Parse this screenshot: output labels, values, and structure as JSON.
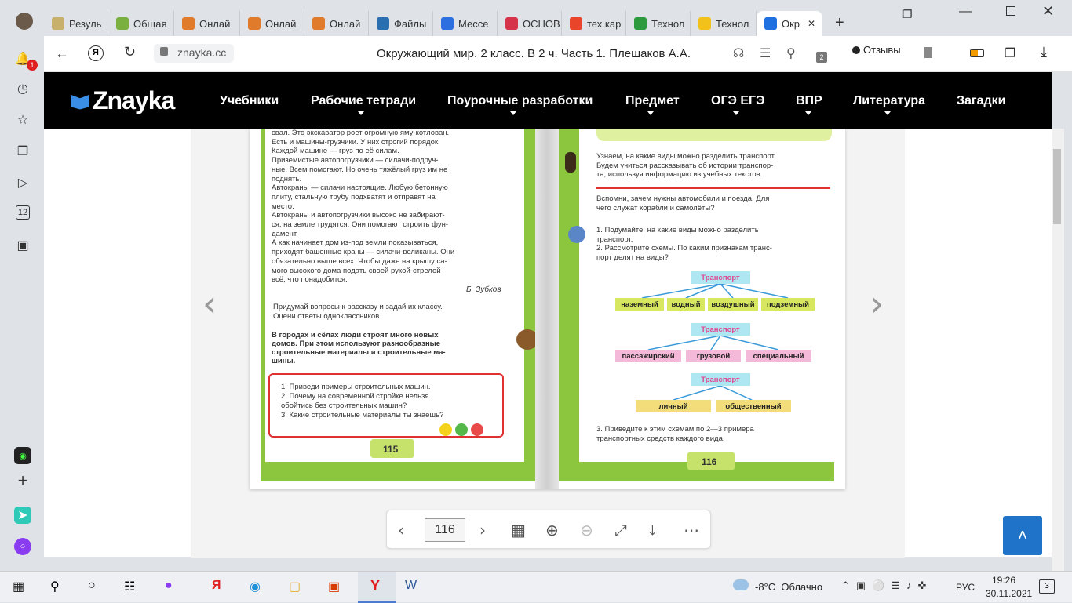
{
  "tabs": [
    {
      "label": "Резуль",
      "color": "#c7b06b"
    },
    {
      "label": "Общая",
      "color": "#7ab03f"
    },
    {
      "label": "Онлай",
      "color": "#e07b2c"
    },
    {
      "label": "Онлай",
      "color": "#e07b2c"
    },
    {
      "label": "Онлай",
      "color": "#e07b2c"
    },
    {
      "label": "Файлы",
      "color": "#2a6fb0"
    },
    {
      "label": "Мессе",
      "color": "#2b6fe0"
    },
    {
      "label": "ОСНОВ",
      "color": "#d6324a"
    },
    {
      "label": "тех кар",
      "color": "#e8452b"
    },
    {
      "label": "Технол",
      "color": "#2e9a3e"
    },
    {
      "label": "Технол",
      "color": "#f2c21b"
    },
    {
      "label": "Окр",
      "color": "#1e6fe0"
    }
  ],
  "address": {
    "domain": "znayka.cc",
    "title": "Окружающий мир. 2 класс. В 2 ч. Часть 1. Плешаков А.А.",
    "reviews": "Отзывы",
    "badge": "2"
  },
  "logo": "Znayka",
  "nav": [
    "Учебники",
    "Рабочие тетради",
    "Поурочные разработки",
    "Предмет",
    "ОГЭ ЕГЭ",
    "ВПР",
    "Литература",
    "Загадки"
  ],
  "book": {
    "left_text": [
      "свал. Это экскаватор роет огромную яму-котлован.",
      "Есть и машины-грузчики. У них строгий порядок.",
      "Каждой машине — груз по её силам.",
      "Приземистые автопогрузчики — силачи-подруч-",
      "ные. Всем помогают. Но очень тяжёлый груз им не",
      "поднять.",
      "Автокраны — силачи настоящие. Любую бетонную",
      "плиту, стальную трубу подхватят и отправят на",
      "место.",
      "Автокраны и автопогрузчики высоко не забирают-",
      "ся, на земле трудятся. Они помогают строить фун-",
      "дамент.",
      "А как начинает дом из-под земли показываться,",
      "приходят башенные краны — силачи-великаны. Они",
      "обязательно выше всех. Чтобы даже на крышу са-",
      "мого высокого дома подать своей рукой-стрелой",
      "всё, что понадобится."
    ],
    "author": "Б. Зубков",
    "task": [
      "Придумай вопросы к рассказу и задай их классу.",
      "Оцени ответы одноклассников."
    ],
    "bold": [
      "В городах и сёлах люди строят много новых",
      "домов. При этом используют разнообразные",
      "строительные материалы и строительные ма-",
      "шины."
    ],
    "questions": [
      "1. Приведи примеры строительных машин.",
      "2. Почему на современной стройке нельзя",
      "обойтись без строительных машин?",
      "3. Какие строительные материалы ты знаешь?"
    ],
    "page_left": "115",
    "right_intro": [
      "Узнаем, на какие виды можно разделить транспорт.",
      "Будем учиться рассказывать об истории транспор-",
      "та, используя информацию из учебных текстов."
    ],
    "right_q": [
      "Вспомни, зачем нужны автомобили и поезда. Для",
      "чего служат корабли и самолёты?"
    ],
    "right_tasks": [
      "1. Подумайте, на какие виды можно разделить",
      "транспорт.",
      "2. Рассмотрите схемы. По каким признакам транс-",
      "порт делят на виды?"
    ],
    "scheme_head": "Транспорт",
    "scheme1": [
      "наземный",
      "водный",
      "воздушный",
      "подземный"
    ],
    "scheme2": [
      "пассажирский",
      "грузовой",
      "специальный"
    ],
    "scheme3": [
      "личный",
      "общественный"
    ],
    "right_end": [
      "3. Приведите к этим схемам по 2—3 примера",
      "транспортных средств каждого вида."
    ],
    "page_right": "116"
  },
  "toolbar": {
    "page": "116"
  },
  "taskbar": {
    "weather": "-8°C  Облачно",
    "lang": "РУС",
    "time": "19:26",
    "date": "30.11.2021",
    "notif": "3"
  }
}
